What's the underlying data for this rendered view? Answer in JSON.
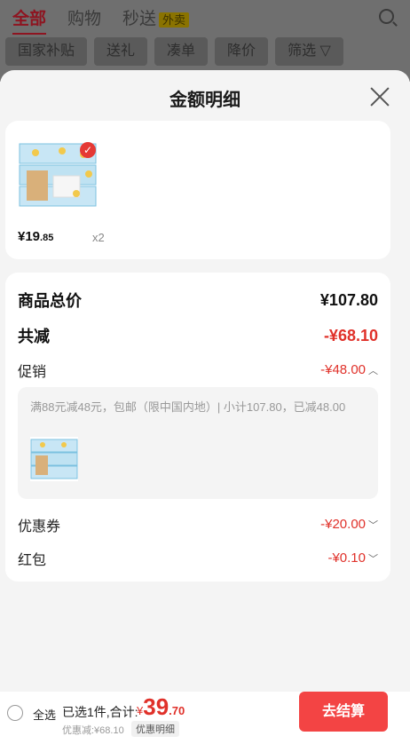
{
  "bg": {
    "tabs": [
      "全部",
      "购物",
      "秒送"
    ],
    "waimai_badge": "外卖",
    "filters": [
      "国家补贴",
      "送礼",
      "凑单",
      "降价",
      "筛选"
    ]
  },
  "sheet": {
    "title": "金额明细",
    "product": {
      "price_symbol": "¥19",
      "price_decimal": ".85",
      "qty": "x2"
    },
    "rows": {
      "total_label": "商品总价",
      "total_value": "¥107.80",
      "reduce_label": "共减",
      "reduce_value": "-¥68.10",
      "promo_label": "促销",
      "promo_value": "-¥48.00",
      "promo_desc": "满88元减48元，包邮（限中国内地）| 小计107.80，已减48.00",
      "coupon_label": "优惠券",
      "coupon_value": "-¥20.00",
      "redpacket_label": "红包",
      "redpacket_value": "-¥0.10"
    }
  },
  "bottom": {
    "select_all": "全选",
    "selected_text": "已选1件,合计:",
    "total_currency": "¥",
    "total_int": "39",
    "total_dec": ".70",
    "discount_text": "优惠减:¥68.10",
    "detail_btn": "优惠明细",
    "checkout_btn": "去结算"
  },
  "colors": {
    "accent": "#e0312a",
    "checkout": "#f34444"
  }
}
